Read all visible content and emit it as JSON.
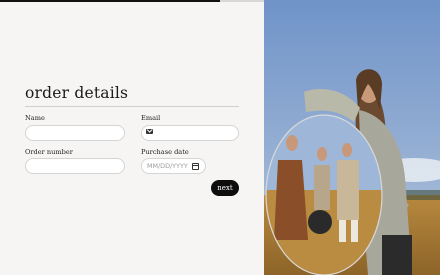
{
  "progress": {
    "fraction": 0.5
  },
  "form": {
    "title": "order details",
    "name_label": "Name",
    "email_label": "Email",
    "order_number_label": "Order number",
    "purchase_date_label": "Purchase date",
    "name_value": "",
    "email_value": "",
    "order_number_value": "",
    "purchase_date_placeholder": "MM/DD/YYYY",
    "next_label": "next"
  },
  "icons": {
    "email": "envelope-icon",
    "date": "calendar-icon"
  }
}
